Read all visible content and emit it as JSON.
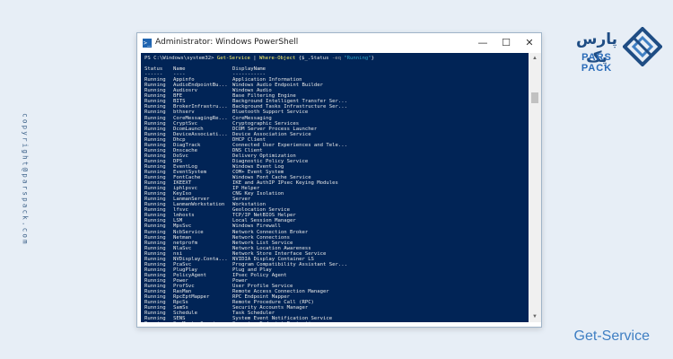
{
  "watermark": {
    "copyright": "copyright@parspack.com"
  },
  "logo": {
    "name_fa": "پارس پک",
    "name_en": "PARS PACK"
  },
  "caption": "Get-Service",
  "window": {
    "title": "Administrator: Windows PowerShell",
    "controls": {
      "minimize": "—",
      "maximize": "☐",
      "close": "✕"
    },
    "icon_glyph": ">_"
  },
  "console": {
    "prompt": "PS C:\\Windows\\system32> ",
    "cmdlet": "Get-Service",
    "pipe": " | ",
    "filter_cmdlet": "Where-Object",
    "filter_open": " {$_.Status ",
    "filter_op": "-eq",
    "filter_sp": " ",
    "filter_value": "\"Running\"",
    "filter_close": "}",
    "headers": {
      "status": "Status",
      "name": "Name",
      "display": "DisplayName"
    },
    "underlines": {
      "status": "------",
      "name": "----",
      "display": "-----------"
    },
    "rows": [
      [
        "Running",
        "Appinfo",
        "Application Information"
      ],
      [
        "Running",
        "AudioEndpointBu...",
        "Windows Audio Endpoint Builder"
      ],
      [
        "Running",
        "Audiosrv",
        "Windows Audio"
      ],
      [
        "Running",
        "BFE",
        "Base Filtering Engine"
      ],
      [
        "Running",
        "BITS",
        "Background Intelligent Transfer Ser..."
      ],
      [
        "Running",
        "BrokerInfrastru...",
        "Background Tasks Infrastructure Ser..."
      ],
      [
        "Running",
        "bthserv",
        "Bluetooth Support Service"
      ],
      [
        "Running",
        "CoreMessagingRe...",
        "CoreMessaging"
      ],
      [
        "Running",
        "CryptSvc",
        "Cryptographic Services"
      ],
      [
        "Running",
        "DcomLaunch",
        "DCOM Server Process Launcher"
      ],
      [
        "Running",
        "DeviceAssociati...",
        "Device Association Service"
      ],
      [
        "Running",
        "Dhcp",
        "DHCP Client"
      ],
      [
        "Running",
        "DiagTrack",
        "Connected User Experiences and Tele..."
      ],
      [
        "Running",
        "Dnscache",
        "DNS Client"
      ],
      [
        "Running",
        "DoSvc",
        "Delivery Optimization"
      ],
      [
        "Running",
        "DPS",
        "Diagnostic Policy Service"
      ],
      [
        "Running",
        "EventLog",
        "Windows Event Log"
      ],
      [
        "Running",
        "EventSystem",
        "COM+ Event System"
      ],
      [
        "Running",
        "FontCache",
        "Windows Font Cache Service"
      ],
      [
        "Running",
        "IKEEXT",
        "IKE and AuthIP IPsec Keying Modules"
      ],
      [
        "Running",
        "iphlpsvc",
        "IP Helper"
      ],
      [
        "Running",
        "KeyIso",
        "CNG Key Isolation"
      ],
      [
        "Running",
        "LanmanServer",
        "Server"
      ],
      [
        "Running",
        "LanmanWorkstation",
        "Workstation"
      ],
      [
        "Running",
        "lfsvc",
        "Geolocation Service"
      ],
      [
        "Running",
        "lmhosts",
        "TCP/IP NetBIOS Helper"
      ],
      [
        "Running",
        "LSM",
        "Local Session Manager"
      ],
      [
        "Running",
        "MpsSvc",
        "Windows Firewall"
      ],
      [
        "Running",
        "NcbService",
        "Network Connection Broker"
      ],
      [
        "Running",
        "Netman",
        "Network Connections"
      ],
      [
        "Running",
        "netprofm",
        "Network List Service"
      ],
      [
        "Running",
        "NlaSvc",
        "Network Location Awareness"
      ],
      [
        "Running",
        "nsi",
        "Network Store Interface Service"
      ],
      [
        "Running",
        "NVDisplay.Conta...",
        "NVIDIA Display Container LS"
      ],
      [
        "Running",
        "PcaSvc",
        "Program Compatibility Assistant Ser..."
      ],
      [
        "Running",
        "PlugPlay",
        "Plug and Play"
      ],
      [
        "Running",
        "PolicyAgent",
        "IPsec Policy Agent"
      ],
      [
        "Running",
        "Power",
        "Power"
      ],
      [
        "Running",
        "ProfSvc",
        "User Profile Service"
      ],
      [
        "Running",
        "RasMan",
        "Remote Access Connection Manager"
      ],
      [
        "Running",
        "RpcEptMapper",
        "RPC Endpoint Mapper"
      ],
      [
        "Running",
        "RpcSs",
        "Remote Procedure Call (RPC)"
      ],
      [
        "Running",
        "SamSs",
        "Security Accounts Manager"
      ],
      [
        "Running",
        "Schedule",
        "Task Scheduler"
      ],
      [
        "Running",
        "SENS",
        "System Event Notification Service"
      ],
      [
        "Running",
        "SepMasterService",
        "Symantec Endpoint Protection"
      ]
    ]
  },
  "colors": {
    "console_bg": "#012456",
    "cmdlet": "#fff36b",
    "string": "#2fa6c9",
    "brand": "#1f4d84",
    "caption": "#3f7fc3"
  }
}
